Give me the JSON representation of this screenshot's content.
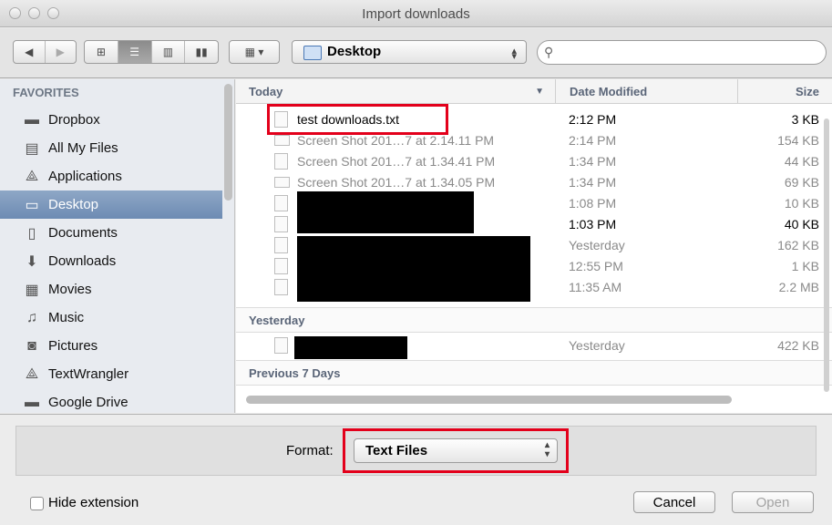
{
  "window": {
    "title": "Import downloads"
  },
  "toolbar": {
    "back_icon": "back-arrow-icon",
    "forward_icon": "forward-arrow-icon",
    "view_modes": [
      "icon-view-icon",
      "list-view-icon",
      "column-view-icon",
      "coverflow-view-icon"
    ],
    "active_view": "list-view-icon",
    "arrange_icon": "arrange-icon",
    "location": "Desktop",
    "search_placeholder": ""
  },
  "sidebar": {
    "heading": "FAVORITES",
    "items": [
      {
        "label": "Dropbox",
        "icon": "folder-icon"
      },
      {
        "label": "All My Files",
        "icon": "all-files-icon"
      },
      {
        "label": "Applications",
        "icon": "applications-icon"
      },
      {
        "label": "Desktop",
        "icon": "desktop-icon",
        "selected": true
      },
      {
        "label": "Documents",
        "icon": "documents-icon"
      },
      {
        "label": "Downloads",
        "icon": "downloads-icon"
      },
      {
        "label": "Movies",
        "icon": "movies-icon"
      },
      {
        "label": "Music",
        "icon": "music-icon"
      },
      {
        "label": "Pictures",
        "icon": "pictures-icon"
      },
      {
        "label": "TextWrangler",
        "icon": "applications-icon"
      },
      {
        "label": "Google Drive",
        "icon": "folder-icon"
      }
    ]
  },
  "list": {
    "columns": {
      "name": "Today",
      "date": "Date Modified",
      "size": "Size"
    },
    "sections": {
      "yesterday": "Yesterday",
      "previous": "Previous 7 Days"
    },
    "rows": [
      {
        "name": "test downloads.txt",
        "date": "2:12 PM",
        "size": "3 KB",
        "enabled": true
      },
      {
        "name": "Screen Shot 201…7 at 2.14.11 PM",
        "date": "2:14 PM",
        "size": "154 KB",
        "enabled": false
      },
      {
        "name": "Screen Shot 201…7 at 1.34.41 PM",
        "date": "1:34 PM",
        "size": "44 KB",
        "enabled": false
      },
      {
        "name": "Screen Shot 201…7 at 1.34.05 PM",
        "date": "1:34 PM",
        "size": "69 KB",
        "enabled": false
      },
      {
        "name": "",
        "date": "1:08 PM",
        "size": "10 KB",
        "enabled": false
      },
      {
        "name": "",
        "date": "1:03 PM",
        "size": "40 KB",
        "enabled": true
      },
      {
        "name": "",
        "date": "Yesterday",
        "size": "162 KB",
        "enabled": false
      },
      {
        "name": "",
        "date": "12:55 PM",
        "size": "1 KB",
        "enabled": false
      },
      {
        "name": "",
        "date": "11:35 AM",
        "size": "2.2 MB",
        "enabled": false
      }
    ],
    "yesterday_rows": [
      {
        "name": "",
        "date": "Yesterday",
        "size": "422 KB",
        "enabled": false
      }
    ]
  },
  "bottom": {
    "format_label": "Format:",
    "format_value": "Text Files",
    "hide_extension_label": "Hide extension",
    "hide_extension_checked": false,
    "cancel_label": "Cancel",
    "open_label": "Open"
  },
  "colors": {
    "highlight": "#e3001b",
    "selection": "#7793b8"
  }
}
